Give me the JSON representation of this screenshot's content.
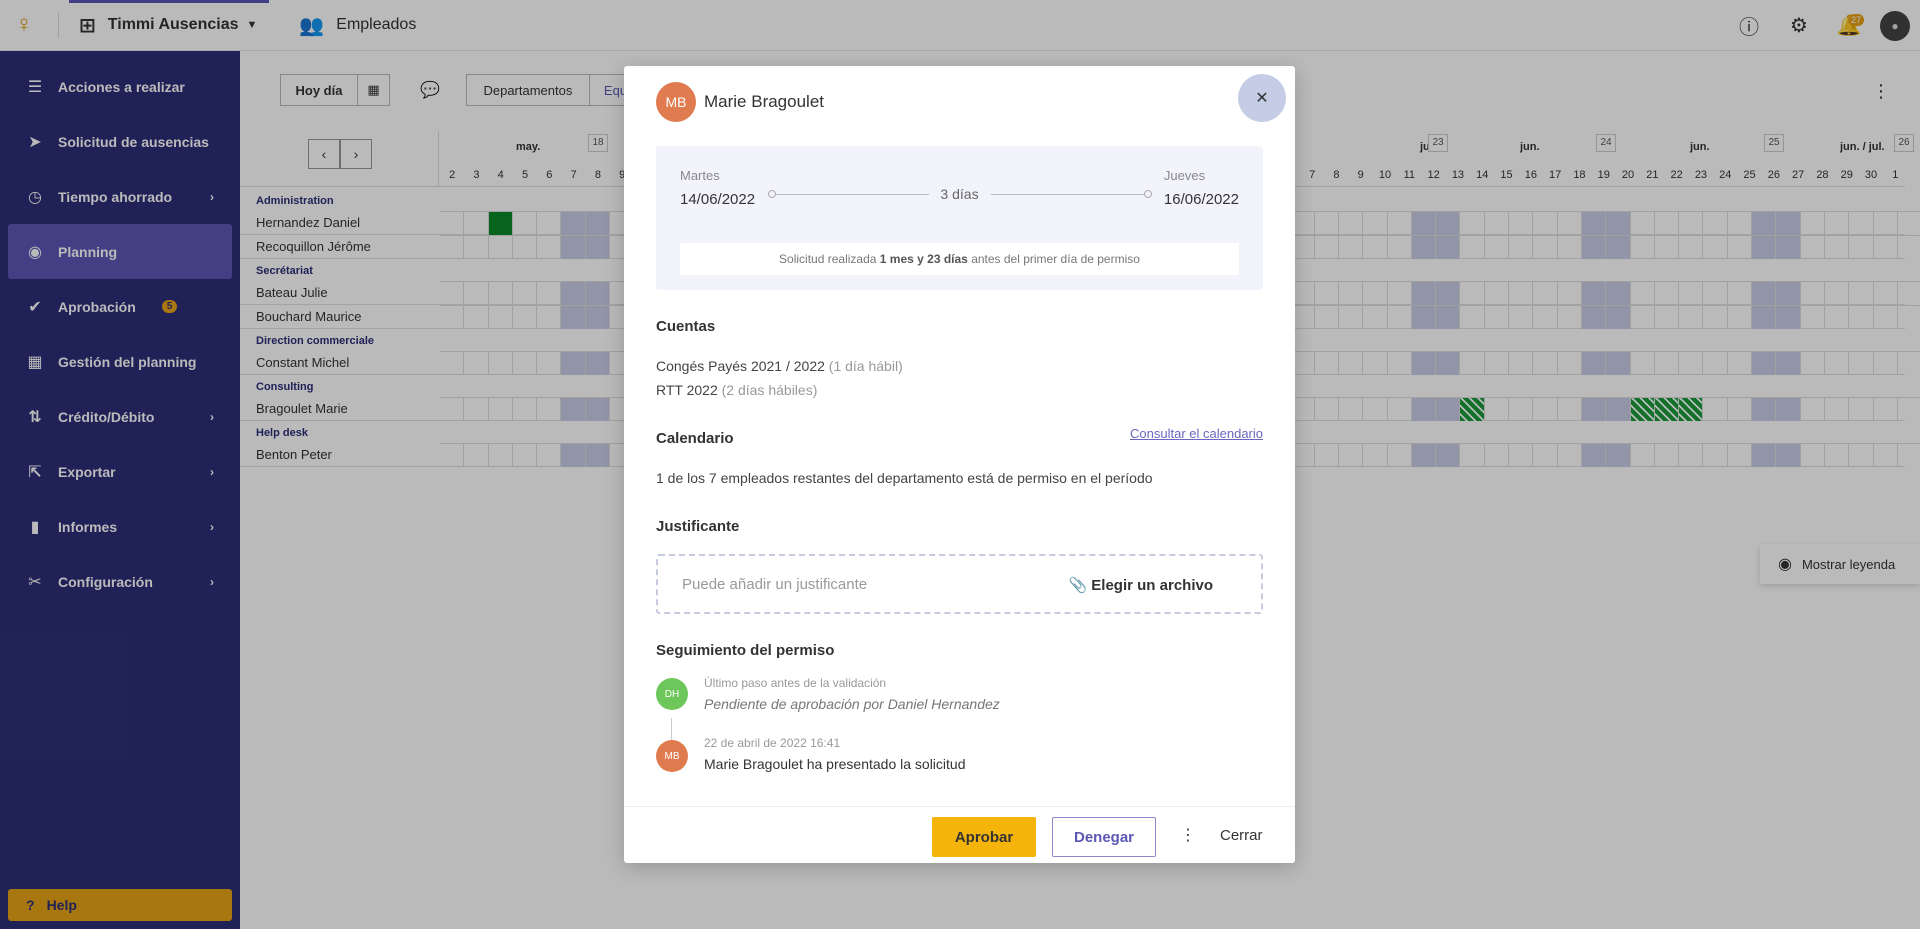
{
  "topbar": {
    "app_name": "Timmi Ausencias",
    "section": "Empleados",
    "notif_count": "27"
  },
  "sidebar": {
    "items": [
      {
        "label": "Acciones a realizar",
        "icon": "tasks-icon"
      },
      {
        "label": "Solicitud de ausencias",
        "icon": "send-icon"
      },
      {
        "label": "Tiempo ahorrado",
        "icon": "clock-icon"
      },
      {
        "label": "Planning",
        "icon": "eye-icon"
      },
      {
        "label": "Aprobación",
        "icon": "check-icon",
        "badge": "5"
      },
      {
        "label": "Gestión del planning",
        "icon": "calendar-settings-icon"
      },
      {
        "label": "Crédito/Débito",
        "icon": "sort-icon"
      },
      {
        "label": "Exportar",
        "icon": "export-icon"
      },
      {
        "label": "Informes",
        "icon": "chart-icon"
      },
      {
        "label": "Configuración",
        "icon": "tools-icon"
      }
    ],
    "help": "Help"
  },
  "toolbar": {
    "today": "Hoy día",
    "tab_dept": "Departamentos",
    "tab_team": "Equi"
  },
  "calendar": {
    "months": [
      "may.",
      "jun.",
      "jun.",
      "jun.",
      "jun. / jul."
    ],
    "weeks": [
      "18",
      "23",
      "24",
      "25",
      "26"
    ],
    "days_left": [
      "2",
      "3",
      "4",
      "5",
      "6",
      "7",
      "8",
      "9"
    ],
    "days_right": [
      "7",
      "8",
      "9",
      "10",
      "11",
      "12",
      "13",
      "14",
      "15",
      "16",
      "17",
      "18",
      "19",
      "20",
      "21",
      "22",
      "23",
      "24",
      "25",
      "26",
      "27",
      "28",
      "29",
      "30",
      "1"
    ],
    "depts": [
      {
        "name": "Administration",
        "employees": [
          "Hernandez Daniel",
          "Recoquillon Jérôme"
        ]
      },
      {
        "name": "Secrétariat",
        "employees": [
          "Bateau Julie",
          "Bouchard Maurice"
        ]
      },
      {
        "name": "Direction commerciale",
        "employees": [
          "Constant Michel"
        ]
      },
      {
        "name": "Consulting",
        "employees": [
          "Bragoulet Marie"
        ]
      },
      {
        "name": "Help desk",
        "employees": [
          "Benton Peter"
        ]
      }
    ],
    "legend": "Mostrar leyenda"
  },
  "modal": {
    "initials": "MB",
    "name": "Marie Bragoulet",
    "start_day": "Martes",
    "start_date": "14/06/2022",
    "end_day": "Jueves",
    "end_date": "16/06/2022",
    "duration": "3 días",
    "request_pre": "Solicitud realizada",
    "request_bold": "1 mes y 23 días",
    "request_post": "antes del primer día de permiso",
    "accounts_title": "Cuentas",
    "accounts": [
      {
        "name": "Congés Payés 2021 / 2022",
        "detail": "(1 día hábil)"
      },
      {
        "name": "RTT 2022",
        "detail": "(2 días hábiles)"
      }
    ],
    "calendar_title": "Calendario",
    "calendar_link": "Consultar el calendario",
    "calendar_text": "1 de los 7 empleados restantes del departamento está de permiso en el período",
    "justif_title": "Justificante",
    "justif_placeholder": "Puede añadir un justificante",
    "justif_choose": "Elegir un archivo",
    "follow_title": "Seguimiento del permiso",
    "steps": [
      {
        "initials": "DH",
        "meta": "Último paso antes de la validación",
        "text": "Pendiente de aprobación por Daniel Hernandez",
        "color": "#6dc75a"
      },
      {
        "initials": "MB",
        "meta": "22 de abril de 2022 16:41",
        "text": "Marie Bragoulet ha presentado la solicitud",
        "color": "#e07b4f"
      }
    ],
    "approve": "Aprobar",
    "deny": "Denegar",
    "close": "Cerrar"
  }
}
